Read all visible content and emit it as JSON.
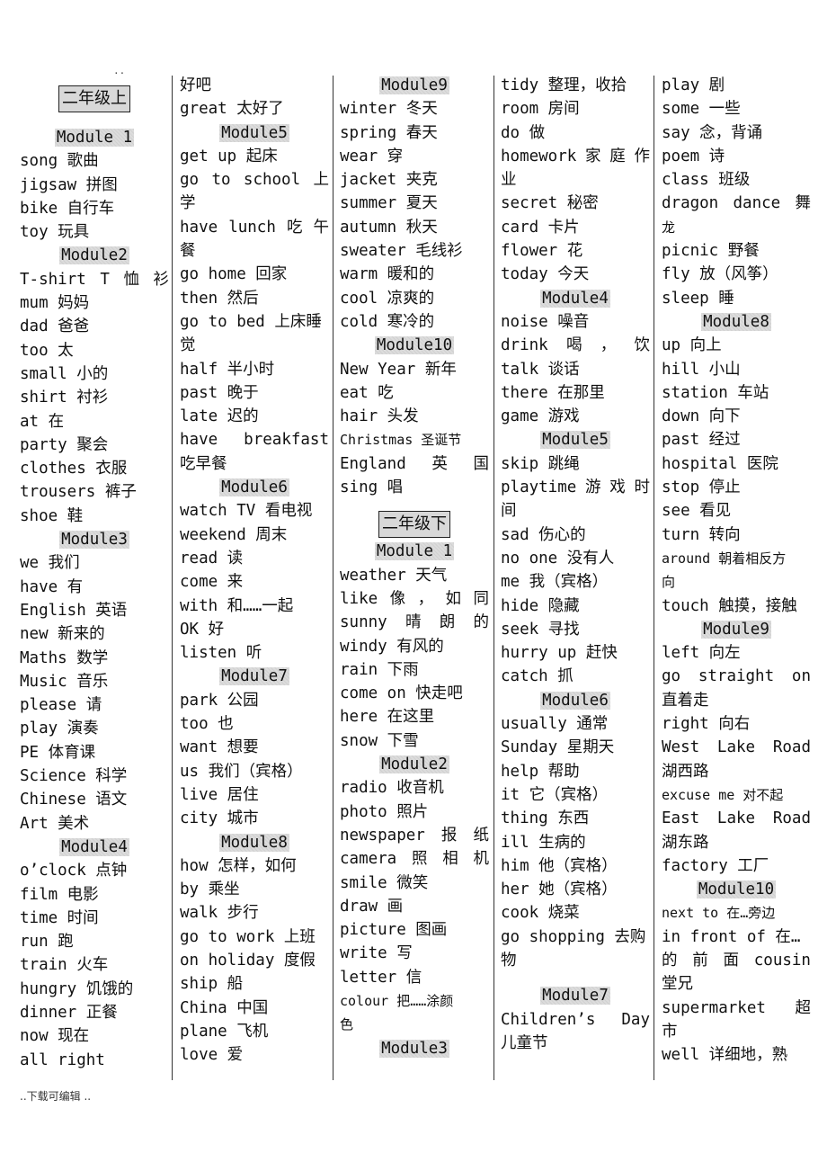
{
  "header_marker": "..",
  "footer": "..下载可编辑 ..",
  "columns": [
    [
      {
        "t": "grade",
        "v": "二年级上"
      },
      {
        "t": "gap"
      },
      {
        "t": "mod",
        "v": "Module 1"
      },
      {
        "t": "w",
        "v": "song 歌曲"
      },
      {
        "t": "w",
        "v": "jigsaw 拼图"
      },
      {
        "t": "w",
        "v": "bike 自行车"
      },
      {
        "t": "w",
        "v": "toy 玩具"
      },
      {
        "t": "mod",
        "v": "Module2"
      },
      {
        "t": "w",
        "v": "T-shirt T 恤衫",
        "j": true
      },
      {
        "t": "w",
        "v": "mum 妈妈"
      },
      {
        "t": "w",
        "v": "dad 爸爸"
      },
      {
        "t": "w",
        "v": "too 太"
      },
      {
        "t": "w",
        "v": "small 小的"
      },
      {
        "t": "w",
        "v": "shirt 衬衫"
      },
      {
        "t": "w",
        "v": "at 在"
      },
      {
        "t": "w",
        "v": "party 聚会"
      },
      {
        "t": "w",
        "v": "clothes 衣服"
      },
      {
        "t": "w",
        "v": "trousers 裤子"
      },
      {
        "t": "w",
        "v": "shoe 鞋"
      },
      {
        "t": "mod",
        "v": "Module3"
      },
      {
        "t": "w",
        "v": "we 我们"
      },
      {
        "t": "w",
        "v": "have 有"
      },
      {
        "t": "w",
        "v": "English 英语"
      },
      {
        "t": "w",
        "v": "new 新来的"
      },
      {
        "t": "w",
        "v": "Maths 数学"
      },
      {
        "t": "w",
        "v": "Music 音乐"
      },
      {
        "t": "w",
        "v": "please 请"
      },
      {
        "t": "w",
        "v": "play 演奏"
      },
      {
        "t": "w",
        "v": "PE 体育课"
      },
      {
        "t": "w",
        "v": "Science 科学"
      },
      {
        "t": "w",
        "v": "Chinese 语文"
      },
      {
        "t": "w",
        "v": "Art 美术"
      },
      {
        "t": "mod",
        "v": "Module4"
      },
      {
        "t": "w",
        "v": "o’clock 点钟"
      },
      {
        "t": "w",
        "v": "film 电影"
      },
      {
        "t": "w",
        "v": "time 时间"
      },
      {
        "t": "w",
        "v": "run 跑"
      },
      {
        "t": "w",
        "v": "train 火车"
      },
      {
        "t": "w",
        "v": "hungry 饥饿的"
      },
      {
        "t": "w",
        "v": "dinner 正餐"
      },
      {
        "t": "w",
        "v": "now 现在"
      },
      {
        "t": "w",
        "v": "all right"
      }
    ],
    [
      {
        "t": "w",
        "v": "好吧"
      },
      {
        "t": "w",
        "v": "great 太好了"
      },
      {
        "t": "mod",
        "v": "Module5"
      },
      {
        "t": "w",
        "v": "get up 起床"
      },
      {
        "t": "w",
        "v": "go to school 上",
        "j": true
      },
      {
        "t": "w",
        "v": "学"
      },
      {
        "t": "w",
        "v": "have lunch 吃午",
        "j": true
      },
      {
        "t": "w",
        "v": "餐"
      },
      {
        "t": "w",
        "v": "go home 回家"
      },
      {
        "t": "w",
        "v": "then 然后"
      },
      {
        "t": "w",
        "v": "go to bed 上床睡"
      },
      {
        "t": "w",
        "v": "觉"
      },
      {
        "t": "w",
        "v": "half 半小时"
      },
      {
        "t": "w",
        "v": "past 晚于"
      },
      {
        "t": "w",
        "v": "late 迟的"
      },
      {
        "t": "w",
        "v": "have breakfast",
        "j": true
      },
      {
        "t": "w",
        "v": "吃早餐"
      },
      {
        "t": "mod",
        "v": "Module6"
      },
      {
        "t": "w",
        "v": "watch TV 看电视"
      },
      {
        "t": "w",
        "v": "weekend 周末"
      },
      {
        "t": "w",
        "v": "read 读"
      },
      {
        "t": "w",
        "v": "come 来"
      },
      {
        "t": "w",
        "v": "with 和……一起"
      },
      {
        "t": "w",
        "v": "OK 好"
      },
      {
        "t": "w",
        "v": "listen 听"
      },
      {
        "t": "mod",
        "v": "Module7"
      },
      {
        "t": "w",
        "v": "park 公园"
      },
      {
        "t": "w",
        "v": "too 也"
      },
      {
        "t": "w",
        "v": "want 想要"
      },
      {
        "t": "w",
        "v": "us 我们（宾格）"
      },
      {
        "t": "w",
        "v": "live 居住"
      },
      {
        "t": "w",
        "v": "city 城市"
      },
      {
        "t": "mod",
        "v": "Module8"
      },
      {
        "t": "w",
        "v": "how 怎样，如何"
      },
      {
        "t": "w",
        "v": "by 乘坐"
      },
      {
        "t": "w",
        "v": "walk 步行"
      },
      {
        "t": "w",
        "v": "go to work 上班"
      },
      {
        "t": "w",
        "v": "on holiday 度假"
      },
      {
        "t": "w",
        "v": "ship 船"
      },
      {
        "t": "w",
        "v": "China 中国"
      },
      {
        "t": "w",
        "v": "plane 飞机"
      },
      {
        "t": "w",
        "v": "love 爱"
      }
    ],
    [
      {
        "t": "mod",
        "v": "Module9"
      },
      {
        "t": "w",
        "v": "winter 冬天"
      },
      {
        "t": "w",
        "v": "spring 春天"
      },
      {
        "t": "w",
        "v": "wear 穿"
      },
      {
        "t": "w",
        "v": "jacket 夹克"
      },
      {
        "t": "w",
        "v": "summer 夏天"
      },
      {
        "t": "w",
        "v": "autumn 秋天"
      },
      {
        "t": "w",
        "v": "sweater 毛线衫"
      },
      {
        "t": "w",
        "v": "warm 暖和的"
      },
      {
        "t": "w",
        "v": "cool 凉爽的"
      },
      {
        "t": "w",
        "v": "cold 寒冷的"
      },
      {
        "t": "mod",
        "v": "Module10"
      },
      {
        "t": "w",
        "v": "New Year 新年"
      },
      {
        "t": "w",
        "v": "eat 吃"
      },
      {
        "t": "w",
        "v": "hair 头发"
      },
      {
        "t": "w",
        "v": "Christmas 圣诞节",
        "s": true
      },
      {
        "t": "w",
        "v": "England 英 国",
        "j": true
      },
      {
        "t": "w",
        "v": "sing 唱"
      },
      {
        "t": "gap"
      },
      {
        "t": "grade",
        "v": "二年级下"
      },
      {
        "t": "mod",
        "v": "Module 1"
      },
      {
        "t": "w",
        "v": "weather 天气"
      },
      {
        "t": "w",
        "v": "like 像，如同",
        "j": true
      },
      {
        "t": "w",
        "v": "sunny 晴朗的",
        "j": true
      },
      {
        "t": "w",
        "v": "windy 有风的"
      },
      {
        "t": "w",
        "v": "rain 下雨"
      },
      {
        "t": "w",
        "v": "come on 快走吧"
      },
      {
        "t": "w",
        "v": "here 在这里"
      },
      {
        "t": "w",
        "v": "snow 下雪"
      },
      {
        "t": "mod",
        "v": "Module2"
      },
      {
        "t": "w",
        "v": "radio 收音机"
      },
      {
        "t": "w",
        "v": "photo 照片"
      },
      {
        "t": "w",
        "v": "newspaper 报纸",
        "j": true
      },
      {
        "t": "w",
        "v": "camera 照相机",
        "j": true
      },
      {
        "t": "w",
        "v": "smile 微笑"
      },
      {
        "t": "w",
        "v": "draw 画"
      },
      {
        "t": "w",
        "v": "picture 图画"
      },
      {
        "t": "w",
        "v": "write 写"
      },
      {
        "t": "w",
        "v": "letter 信"
      },
      {
        "t": "w",
        "v": "colour 把……涂颜",
        "s": true
      },
      {
        "t": "w",
        "v": "色",
        "s": true
      },
      {
        "t": "mod",
        "v": "Module3"
      }
    ],
    [
      {
        "t": "w",
        "v": "tidy 整理，收拾"
      },
      {
        "t": "w",
        "v": "room 房间"
      },
      {
        "t": "w",
        "v": "do 做"
      },
      {
        "t": "w",
        "v": "homework 家庭作",
        "j": true
      },
      {
        "t": "w",
        "v": "业"
      },
      {
        "t": "w",
        "v": "secret 秘密"
      },
      {
        "t": "w",
        "v": "card 卡片"
      },
      {
        "t": "w",
        "v": "flower 花"
      },
      {
        "t": "w",
        "v": "today 今天"
      },
      {
        "t": "mod",
        "v": "Module4"
      },
      {
        "t": "w",
        "v": "noise 噪音"
      },
      {
        "t": "w",
        "v": "drink 喝，饮",
        "j": true
      },
      {
        "t": "w",
        "v": "talk 谈话"
      },
      {
        "t": "w",
        "v": "there 在那里"
      },
      {
        "t": "w",
        "v": "game 游戏"
      },
      {
        "t": "mod",
        "v": "Module5"
      },
      {
        "t": "w",
        "v": "skip 跳绳"
      },
      {
        "t": "w",
        "v": "playtime 游戏时",
        "j": true
      },
      {
        "t": "w",
        "v": "间"
      },
      {
        "t": "w",
        "v": "sad 伤心的"
      },
      {
        "t": "w",
        "v": "no one 没有人"
      },
      {
        "t": "w",
        "v": "me 我（宾格）"
      },
      {
        "t": "w",
        "v": "hide 隐藏"
      },
      {
        "t": "w",
        "v": "seek 寻找"
      },
      {
        "t": "w",
        "v": "hurry up 赶快"
      },
      {
        "t": "w",
        "v": "catch 抓"
      },
      {
        "t": "mod",
        "v": "Module6"
      },
      {
        "t": "w",
        "v": "usually 通常"
      },
      {
        "t": "w",
        "v": "Sunday 星期天"
      },
      {
        "t": "w",
        "v": "help 帮助"
      },
      {
        "t": "w",
        "v": "it 它（宾格）"
      },
      {
        "t": "w",
        "v": "thing 东西"
      },
      {
        "t": "w",
        "v": "ill 生病的"
      },
      {
        "t": "w",
        "v": "him 他（宾格）"
      },
      {
        "t": "w",
        "v": "her 她（宾格）"
      },
      {
        "t": "w",
        "v": "cook 烧菜"
      },
      {
        "t": "w",
        "v": "go shopping 去购"
      },
      {
        "t": "w",
        "v": "物"
      },
      {
        "t": "gap"
      },
      {
        "t": "mod",
        "v": "Module7"
      },
      {
        "t": "w",
        "v": "Children’s Day",
        "j": true
      },
      {
        "t": "w",
        "v": "儿童节"
      }
    ],
    [
      {
        "t": "w",
        "v": "play 剧"
      },
      {
        "t": "w",
        "v": "some 一些"
      },
      {
        "t": "w",
        "v": "say 念，背诵"
      },
      {
        "t": "w",
        "v": "poem 诗"
      },
      {
        "t": "w",
        "v": "class 班级"
      },
      {
        "t": "w",
        "v": "dragon dance 舞",
        "j": true
      },
      {
        "t": "w",
        "v": "龙",
        "s": true
      },
      {
        "t": "w",
        "v": "picnic 野餐"
      },
      {
        "t": "w",
        "v": "fly 放（风筝）"
      },
      {
        "t": "w",
        "v": "sleep 睡"
      },
      {
        "t": "mod",
        "v": "Module8"
      },
      {
        "t": "w",
        "v": "up 向上"
      },
      {
        "t": "w",
        "v": "hill 小山"
      },
      {
        "t": "w",
        "v": "station 车站"
      },
      {
        "t": "w",
        "v": "down 向下"
      },
      {
        "t": "w",
        "v": "past 经过"
      },
      {
        "t": "w",
        "v": "hospital 医院"
      },
      {
        "t": "w",
        "v": "stop 停止"
      },
      {
        "t": "w",
        "v": "see 看见"
      },
      {
        "t": "w",
        "v": "turn 转向"
      },
      {
        "t": "w",
        "v": "around 朝着相反方",
        "s": true
      },
      {
        "t": "w",
        "v": "向",
        "s": true
      },
      {
        "t": "w",
        "v": "touch 触摸，接触"
      },
      {
        "t": "mod",
        "v": "Module9"
      },
      {
        "t": "w",
        "v": "left 向左"
      },
      {
        "t": "w",
        "v": "go straight on",
        "j": true
      },
      {
        "t": "w",
        "v": "直着走"
      },
      {
        "t": "w",
        "v": "right 向右"
      },
      {
        "t": "w",
        "v": "West Lake Road",
        "j": true
      },
      {
        "t": "w",
        "v": "湖西路"
      },
      {
        "t": "w",
        "v": "excuse me 对不起",
        "s": true
      },
      {
        "t": "w",
        "v": "East Lake Road",
        "j": true
      },
      {
        "t": "w",
        "v": "湖东路"
      },
      {
        "t": "w",
        "v": "factory 工厂"
      },
      {
        "t": "mod",
        "v": "Module10"
      },
      {
        "t": "w",
        "v": "next to 在…旁边",
        "s": true
      },
      {
        "t": "w",
        "v": "in front of 在…"
      },
      {
        "t": "w",
        "v": "的前面 cousin",
        "j": true
      },
      {
        "t": "w",
        "v": "堂兄"
      },
      {
        "t": "w",
        "v": "supermarket 超",
        "j": true
      },
      {
        "t": "w",
        "v": "市"
      },
      {
        "t": "w",
        "v": "well 详细地，熟"
      }
    ]
  ]
}
